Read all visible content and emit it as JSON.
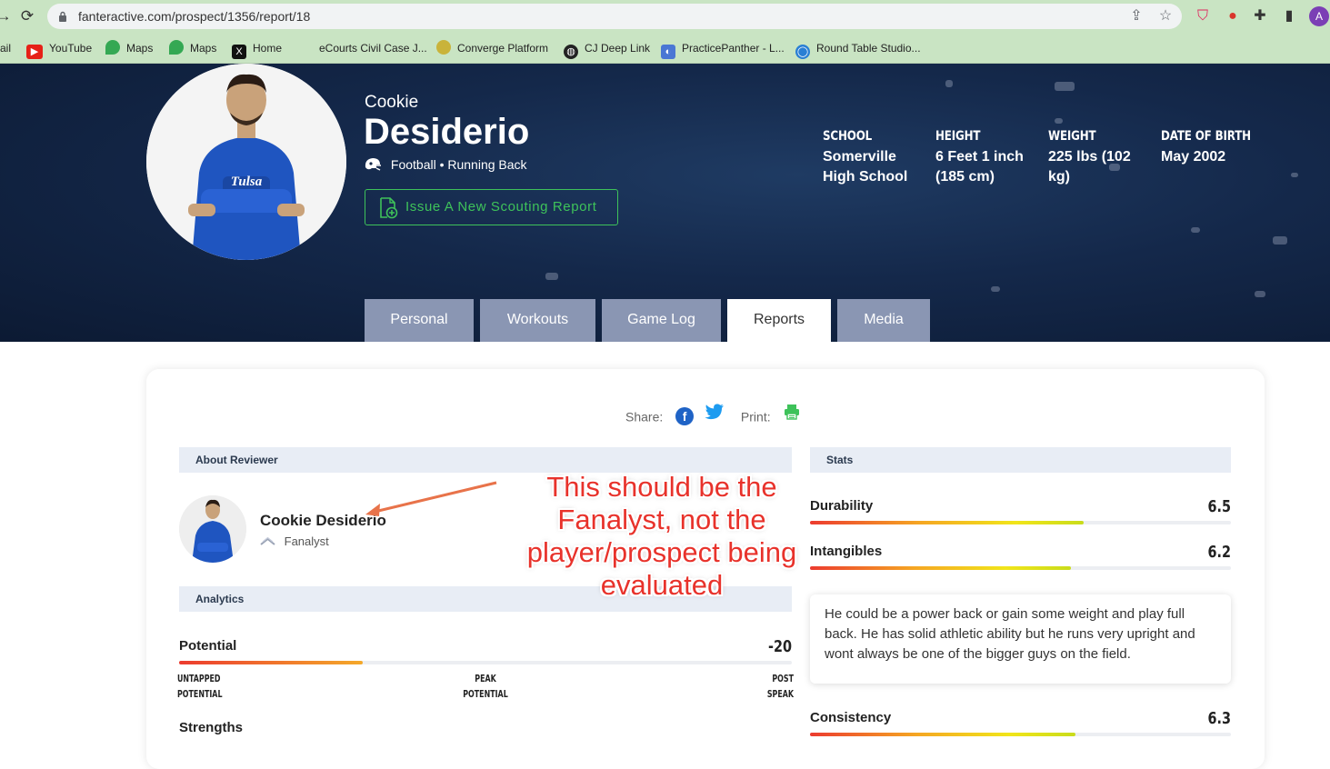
{
  "browser": {
    "url": "fanteractive.com/prospect/1356/report/18",
    "profile_initial": "A",
    "bookmarks": [
      {
        "label": "ail"
      },
      {
        "label": "YouTube"
      },
      {
        "label": "Maps"
      },
      {
        "label": "Maps"
      },
      {
        "label": "Home"
      },
      {
        "label": "eCourts Civil Case J..."
      },
      {
        "label": "Converge Platform"
      },
      {
        "label": "CJ Deep Link"
      },
      {
        "label": "PracticePanther - L..."
      },
      {
        "label": "Round Table Studio..."
      }
    ]
  },
  "profile": {
    "first_name": "Cookie",
    "last_name": "Desiderio",
    "sport_position": "Football • Running Back",
    "issue_button": "Issue A New Scouting Report",
    "meta": [
      {
        "label": "SCHOOL",
        "value": "Somerville High School"
      },
      {
        "label": "HEIGHT",
        "value": "6 Feet 1 inch (185 cm)"
      },
      {
        "label": "WEIGHT",
        "value": "225 lbs (102 kg)"
      },
      {
        "label": "DATE OF BIRTH",
        "value": "May 2002"
      }
    ],
    "tabs": [
      "Personal",
      "Workouts",
      "Game Log",
      "Reports",
      "Media"
    ],
    "active_tab": "Reports"
  },
  "report": {
    "share_label": "Share:",
    "print_label": "Print:",
    "about_reviewer_header": "About Reviewer",
    "reviewer_name": "Cookie Desiderio",
    "reviewer_role": "Fanalyst",
    "analytics_header": "Analytics",
    "potential": {
      "label": "Potential",
      "value": "-20",
      "fill": 0.3,
      "scale_left": [
        "UNTAPPED",
        "POTENTIAL"
      ],
      "scale_mid": [
        "PEAK",
        "POTENTIAL"
      ],
      "scale_right": [
        "POST",
        "SPEAK"
      ]
    },
    "strengths_label": "Strengths",
    "stats_header": "Stats",
    "stats": [
      {
        "label": "Durability",
        "value": "6.5",
        "fill": 0.65
      },
      {
        "label": "Intangibles",
        "value": "6.2",
        "fill": 0.62
      },
      {
        "label": "Consistency",
        "value": "6.3",
        "fill": 0.63
      }
    ],
    "comment": "He could be a power back or gain some weight and play full back. He has solid athletic ability but he runs very upright and wont always be one of the bigger guys on the field."
  },
  "annotation": {
    "line1": "This should be the",
    "line2": "Fanalyst, not the",
    "line3": "player/prospect being",
    "line4": "evaluated"
  },
  "colors": {
    "accent_green": "#3ec25a",
    "tab_bg": "#8a96b3",
    "hero_bg": "#14284a",
    "annotation_red": "#e8322b"
  }
}
